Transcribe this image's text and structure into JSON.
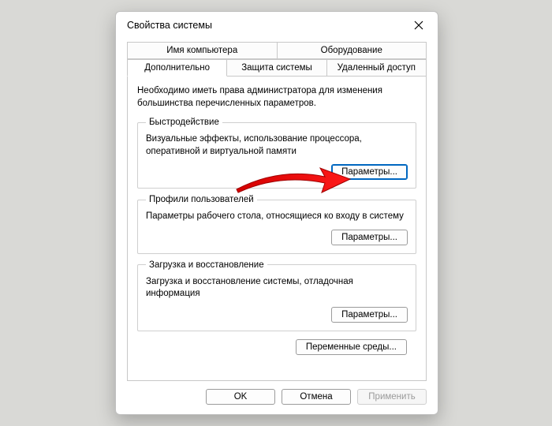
{
  "window": {
    "title": "Свойства системы"
  },
  "tabs": {
    "row1": [
      "Имя компьютера",
      "Оборудование"
    ],
    "row2": [
      "Дополнительно",
      "Защита системы",
      "Удаленный доступ"
    ],
    "active": "Дополнительно"
  },
  "intro": "Необходимо иметь права администратора для изменения большинства перечисленных параметров.",
  "groups": {
    "performance": {
      "legend": "Быстродействие",
      "desc": "Визуальные эффекты, использование процессора, оперативной и виртуальной памяти",
      "button": "Параметры..."
    },
    "profiles": {
      "legend": "Профили пользователей",
      "desc": "Параметры рабочего стола, относящиеся ко входу в систему",
      "button": "Параметры..."
    },
    "startup": {
      "legend": "Загрузка и восстановление",
      "desc": "Загрузка и восстановление системы, отладочная информация",
      "button": "Параметры..."
    }
  },
  "envButton": "Переменные среды...",
  "footer": {
    "ok": "OK",
    "cancel": "Отмена",
    "apply": "Применить"
  }
}
